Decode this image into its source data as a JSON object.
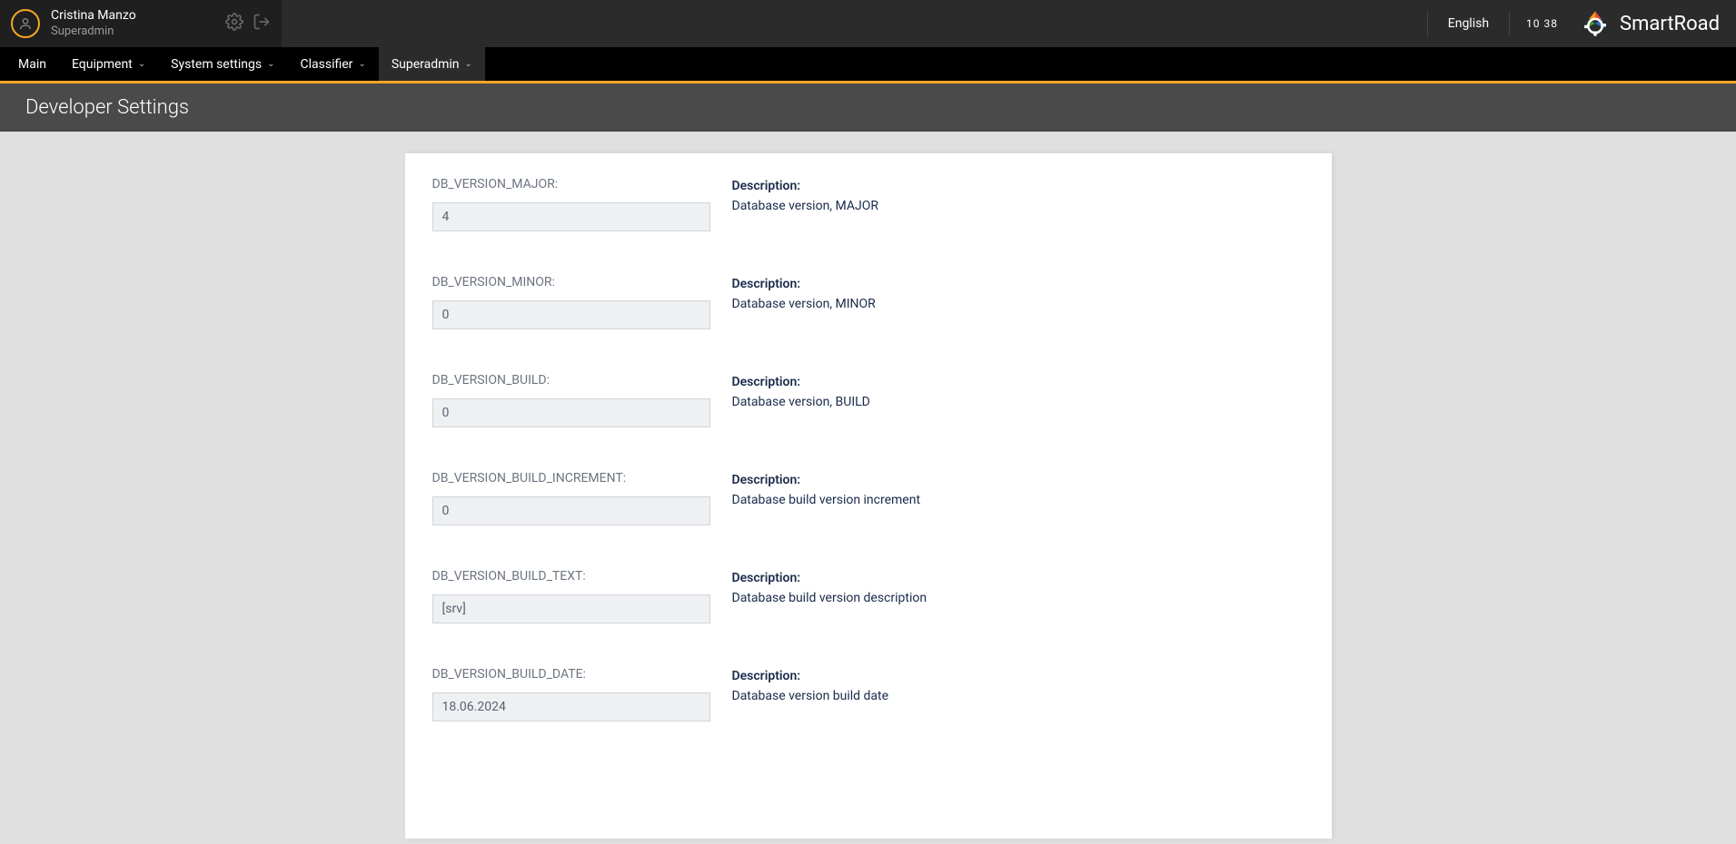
{
  "user": {
    "name": "Cristina Manzo",
    "role": "Superadmin"
  },
  "header": {
    "language": "English",
    "clock": "10 38",
    "brand": "SmartRoad"
  },
  "nav": {
    "items": [
      {
        "label": "Main",
        "dropdown": false,
        "active": false
      },
      {
        "label": "Equipment",
        "dropdown": true,
        "active": false
      },
      {
        "label": "System settings",
        "dropdown": true,
        "active": false
      },
      {
        "label": "Classifier",
        "dropdown": true,
        "active": false
      },
      {
        "label": "Superadmin",
        "dropdown": true,
        "active": true
      }
    ]
  },
  "page": {
    "title": "Developer Settings",
    "desc_heading": "Description:"
  },
  "settings": [
    {
      "label": "DB_VERSION_MAJOR:",
      "value": "4",
      "description": "Database version, MAJOR"
    },
    {
      "label": "DB_VERSION_MINOR:",
      "value": "0",
      "description": "Database version, MINOR"
    },
    {
      "label": "DB_VERSION_BUILD:",
      "value": "0",
      "description": "Database version, BUILD"
    },
    {
      "label": "DB_VERSION_BUILD_INCREMENT:",
      "value": "0",
      "description": "Database build version increment"
    },
    {
      "label": "DB_VERSION_BUILD_TEXT:",
      "value": "[srv]",
      "description": "Database build version description"
    },
    {
      "label": "DB_VERSION_BUILD_DATE:",
      "value": "18.06.2024",
      "description": "Database version build date"
    }
  ]
}
